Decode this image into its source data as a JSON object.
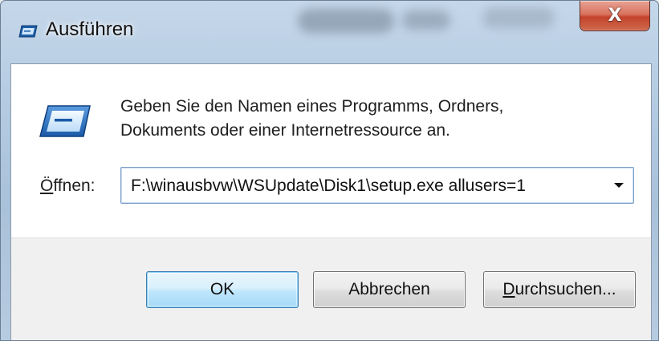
{
  "window": {
    "title": "Ausführen",
    "close_symbol": "X"
  },
  "content": {
    "description_line1": "Geben Sie den Namen eines Programms, Ordners,",
    "description_line2": "Dokuments oder einer Internetressource an.",
    "open_label_accel": "Ö",
    "open_label_rest": "ffnen:",
    "command_value": "F:\\winausbvw\\WSUpdate\\Disk1\\setup.exe allusers=1"
  },
  "buttons": {
    "ok": "OK",
    "cancel": "Abbrechen",
    "browse_accel": "D",
    "browse_rest": "urchsuchen..."
  },
  "icons": {
    "title": "run-dialog-icon",
    "main": "run-dialog-icon",
    "dropdown": "chevron-down-icon",
    "close": "close-icon"
  },
  "colors": {
    "close_button": "#c4432b",
    "default_button": "#bee6fd",
    "footer": "#f0f0f0"
  }
}
